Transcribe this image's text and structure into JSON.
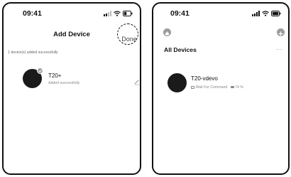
{
  "screens": {
    "left": {
      "status": {
        "time": "09:41"
      },
      "header": {
        "title": "Add Device",
        "done_label": "Done"
      },
      "message": "1 device(s) added successfully",
      "device": {
        "name": "T20+",
        "status": "Added successfully"
      }
    },
    "right": {
      "status": {
        "time": "09:41"
      },
      "title": "All Devices",
      "more_label": "···",
      "device": {
        "name": "T20-vdevo",
        "mode": "Wait For Command",
        "battery": "74 %"
      }
    }
  },
  "colors": {
    "frame": "#111111",
    "avatar": "#1a1a1a",
    "muted_text": "#888888",
    "icon_gray": "#9b9b9b"
  },
  "icons": [
    "signal-icon",
    "wifi-icon",
    "battery-icon",
    "check-icon",
    "edit-icon",
    "robot-icon",
    "add-icon",
    "more-icon",
    "mode-icon",
    "battery-small-icon"
  ]
}
